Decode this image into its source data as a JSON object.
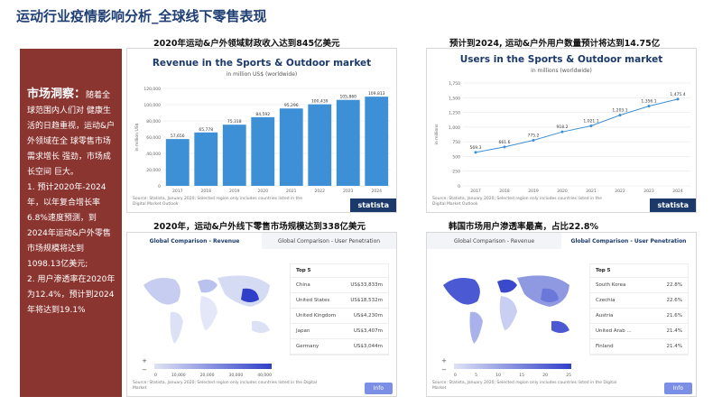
{
  "title": "运动行业疫情影响分析_全球线下零售表现",
  "sidebar": {
    "heading": "市场洞察：",
    "intro": "随着全球范围内人们对 健康生活的日趋重视，运动&户外领域在全 球零售市场需求增长 强劲，市场成长空间 巨大。",
    "point1": "1. 预计2020年-2024年，以年复合增长率6.8%速度预测，到2024年运动&户外零售市场规模将达到1098.13亿美元;",
    "point2": "2. 用户渗透率在2020年为12.4%，预计到2024年将达到19.1%"
  },
  "captions": {
    "top_left": "2020年运动&户外领域财政收入达到845亿美元",
    "top_right": "预计到2024, 运动&户外用户数量预计将达到14.75亿",
    "bottom_left": "2020年，运动&户外线下零售市场规模达到338亿美元",
    "bottom_right": "韩国市场用户渗透率最高，占比22.8%"
  },
  "revenue_chart": {
    "title": "Revenue in the Sports & Outdoor market",
    "subtitle": "in million US$ (worldwide)",
    "ylabel": "in million US$",
    "source": "Source: Statista, January 2020; Selected region only includes countries listed in the Digital Market Outlook",
    "brand": "statista"
  },
  "users_chart": {
    "title": "Users in the Sports & Outdoor market",
    "subtitle": "in millions (worldwide)",
    "ylabel": "in millions",
    "source": "Source: Statista, January 2020; Selected region only includes countries listed in the Digital Market Outlook",
    "brand": "statista"
  },
  "map_left": {
    "tab_active": "Global Comparison - Revenue",
    "tab_inactive": "Global Comparison - User Penetration",
    "legend": [
      "0",
      "10,000",
      "20,000",
      "30,000",
      "40,000"
    ],
    "source": "Source: Statista, January 2020; Selected region only includes countries listed in the Digital Market",
    "info": "Info",
    "zoom_in": "+",
    "zoom_out": "−",
    "top_label": "Top 5",
    "top5": [
      {
        "country": "China",
        "value": "US$33,833m"
      },
      {
        "country": "United States",
        "value": "US$18,532m"
      },
      {
        "country": "United Kingdom",
        "value": "US$4,230m"
      },
      {
        "country": "Japan",
        "value": "US$3,407m"
      },
      {
        "country": "Germany",
        "value": "US$3,044m"
      }
    ]
  },
  "map_right": {
    "tab_inactive": "Global Comparison - Revenue",
    "tab_active": "Global Comparison - User Penetration",
    "legend": [
      "0",
      "5",
      "10",
      "15",
      "20",
      "25"
    ],
    "source": "Source: Statista, January 2020; Selected region only includes countries listed in the Digital Market",
    "info": "Info",
    "zoom_in": "+",
    "zoom_out": "−",
    "top_label": "Top 5",
    "top5": [
      {
        "country": "South Korea",
        "value": "22.8%"
      },
      {
        "country": "Czechia",
        "value": "22.6%"
      },
      {
        "country": "Austria",
        "value": "21.6%"
      },
      {
        "country": "United Arab ...",
        "value": "21.4%"
      },
      {
        "country": "Finland",
        "value": "21.4%"
      }
    ]
  },
  "chart_data": [
    {
      "type": "bar",
      "title": "Revenue in the Sports & Outdoor market",
      "subtitle": "in million US$ (worldwide)",
      "ylabel": "in million US$",
      "categories": [
        "2017",
        "2018",
        "2019",
        "2020",
        "2021",
        "2022",
        "2023",
        "2024"
      ],
      "values": [
        57656,
        65778,
        75318,
        84592,
        95296,
        100439,
        105860,
        109813
      ],
      "value_labels": [
        "57,656",
        "65,778",
        "75,318",
        "84,592",
        "95,296",
        "100,439",
        "105,860",
        "109,813"
      ],
      "yticks": [
        "0",
        "20,000",
        "40,000",
        "60,000",
        "80,000",
        "100,000",
        "120,000"
      ],
      "ylim": [
        0,
        120000
      ],
      "color": "#3d8fd6",
      "grid": true
    },
    {
      "type": "line",
      "title": "Users in the Sports & Outdoor market",
      "subtitle": "in millions (worldwide)",
      "ylabel": "in millions",
      "categories": [
        "2017",
        "2018",
        "2019",
        "2020",
        "2021",
        "2022",
        "2023",
        "2024"
      ],
      "values": [
        569.3,
        661.6,
        775.2,
        918.2,
        1021.1,
        1203.1,
        1356.1,
        1475.4
      ],
      "value_labels": [
        "569.3",
        "661.6",
        "775.2",
        "918.2",
        "1,021.1",
        "1,203.1",
        "1,356.1",
        "1,475.4"
      ],
      "yticks": [
        "0",
        "250",
        "500",
        "750",
        "1,000",
        "1,250",
        "1,500",
        "1,750"
      ],
      "ylim": [
        0,
        1750
      ],
      "color": "#3d8fd6",
      "grid": true
    }
  ]
}
